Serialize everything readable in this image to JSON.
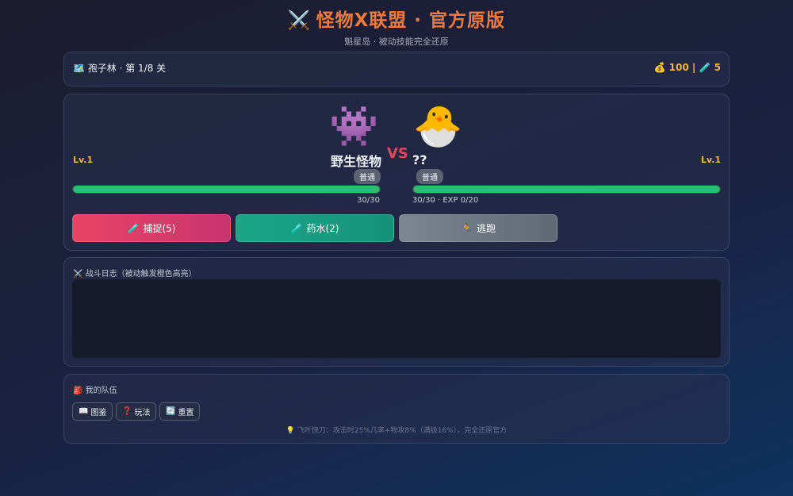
{
  "header": {
    "title_icon": "⚔️",
    "title": "怪物X联盟 · 官方原版",
    "subtitle": "魁星岛 · 被动技能完全还原"
  },
  "stage": {
    "icon": "🗺️",
    "text": "孢子林 · 第 1/8 关",
    "gold_icon": "💰",
    "gold": "100",
    "separator": "|",
    "potion_icon": "🧪",
    "potions": "5"
  },
  "battle": {
    "vs": "VS",
    "enemy": {
      "level": "Lv.1",
      "sprite": "👾",
      "name": "野生怪物",
      "rarity": "普通",
      "hp_text": "30/30",
      "hp_fraction": 1.0
    },
    "player": {
      "level": "Lv.1",
      "sprite": "🐣",
      "name": "??",
      "rarity": "普通",
      "hp_text": "30/30 · EXP 0/20",
      "hp_fraction": 1.0
    },
    "actions": {
      "catch_icon": "🧪",
      "catch_label": "捕捉(5)",
      "potion_icon": "🧪",
      "potion_label": "药水(2)",
      "flee_icon": "🏃",
      "flee_label": "逃跑"
    }
  },
  "log": {
    "icon": "⚔️",
    "title": "战斗日志（被动触发橙色高亮）"
  },
  "team": {
    "icon": "🎒",
    "title": "我的队伍",
    "buttons": {
      "dex_icon": "📖",
      "dex_label": "图鉴",
      "rules_icon": "❓",
      "rules_label": "玩法",
      "reset_icon": "🔄",
      "reset_label": "重置"
    },
    "tip_icon": "💡",
    "tip": "飞叶快刀：攻击时25%几率+物攻8%（满级16%），完全还原官方"
  },
  "colors": {
    "accent_orange": "#f07a3c",
    "gold": "#f4b73a",
    "hp_green": "#2ebe6a",
    "vs_red": "#e8485c",
    "catch_btn": "#e84565",
    "potion_btn": "#1aa687",
    "flee_btn": "#7c8690"
  }
}
